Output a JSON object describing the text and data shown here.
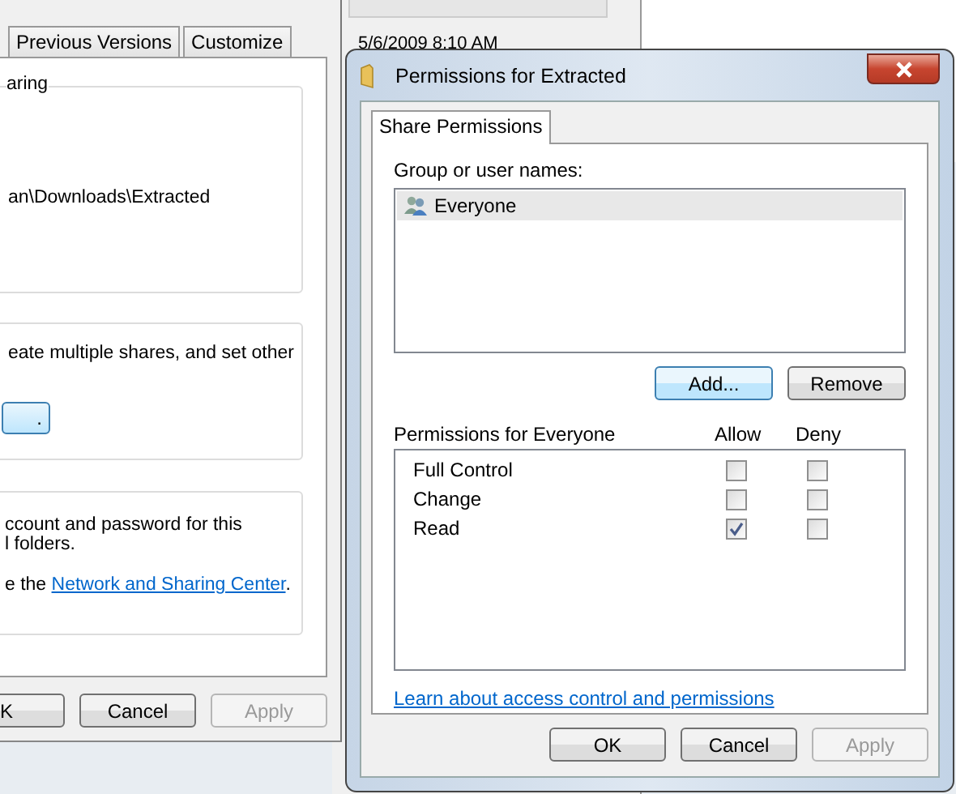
{
  "background_window": {
    "date": "5/6/2009 8:10 AM"
  },
  "background_dialog": {
    "tabs": [
      {
        "label": "Previous Versions",
        "selected": false
      },
      {
        "label": "Customize",
        "selected": false
      }
    ],
    "group_1": {
      "title": "aring",
      "path": "an\\Downloads\\Extracted"
    },
    "group_2": {
      "text": "eate multiple shares, and set other",
      "button": "."
    },
    "group_3": {
      "lines": [
        "ccount and password for this",
        "l folders."
      ],
      "link_prefix": "e the ",
      "link": "Network and Sharing Center",
      "link_suffix": "."
    },
    "buttons": [
      {
        "label": "K",
        "disabled": false
      },
      {
        "label": "Cancel",
        "disabled": false
      },
      {
        "label": "Apply",
        "disabled": true
      }
    ]
  },
  "dialog": {
    "title": "Permissions for Extracted",
    "tabs": [
      {
        "label": "Share Permissions",
        "selected": true
      }
    ],
    "group_label": "Group or user names:",
    "users": [
      {
        "name": "Everyone",
        "selected": true
      }
    ],
    "user_buttons": [
      {
        "label": "Add...",
        "focused": true
      },
      {
        "label": "Remove",
        "focused": false
      }
    ],
    "permissions_label": "Permissions for Everyone",
    "columns": [
      "Allow",
      "Deny"
    ],
    "permissions": [
      {
        "name": "Full Control",
        "allow": false,
        "deny": false
      },
      {
        "name": "Change",
        "allow": false,
        "deny": false
      },
      {
        "name": "Read",
        "allow": true,
        "deny": false
      }
    ],
    "link": "Learn about access control and permissions",
    "buttons": [
      {
        "label": "OK",
        "disabled": false
      },
      {
        "label": "Cancel",
        "disabled": false
      },
      {
        "label": "Apply",
        "disabled": true
      }
    ]
  }
}
